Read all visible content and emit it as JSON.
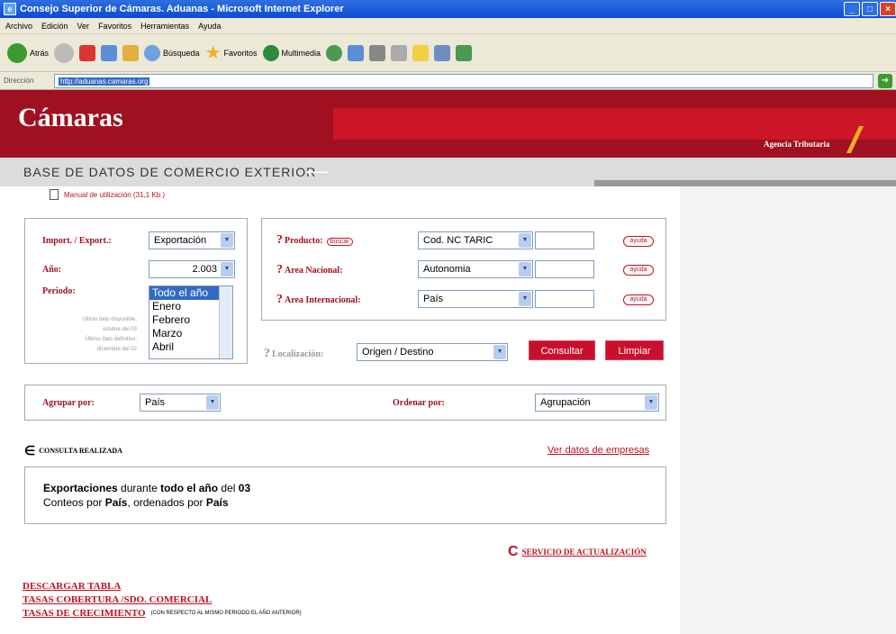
{
  "window": {
    "title": "Consejo Superior de Cámaras. Aduanas - Microsoft Internet Explorer"
  },
  "menu": [
    "Archivo",
    "Edición",
    "Ver",
    "Favoritos",
    "Herramientas",
    "Ayuda"
  ],
  "toolbar": {
    "back": "Atrás",
    "search": "Búsqueda",
    "favorites": "Favoritos",
    "media": "Multimedia"
  },
  "address": {
    "label": "Dirección",
    "url": "http://aduanas.camaras.org"
  },
  "banner": {
    "logo": "Cámaras",
    "agency": "Agencia Tributaria"
  },
  "page_title": "BASE DE DATOS DE COMERCIO EXTERIOR",
  "manual": "Manual de utilización (31,1 Kb.)",
  "left_form": {
    "import_export_label": "Import. / Export.:",
    "import_export_value": "Exportación",
    "year_label": "Año:",
    "year_value": "2.003",
    "period_label": "Periodo:",
    "period_options": [
      "Todo el año",
      "Enero",
      "Febrero",
      "Marzo",
      "Abril"
    ],
    "note_lines": [
      "Último dato disponible:",
      "octubre del 03",
      "Último dato definitivo:",
      "diciembre del 02"
    ]
  },
  "right_form": {
    "product_label": "Producto:",
    "search_button": "buscar",
    "product_value": "Cod. NC TARIC",
    "national_label": "Area Nacional:",
    "national_value": "Autonomia",
    "international_label": "Area Internacional:",
    "international_value": "País",
    "help": "ayuda"
  },
  "location": {
    "label": "Localización:",
    "value": "Origen / Destino"
  },
  "buttons": {
    "consult": "Consultar",
    "clear": "Limpiar"
  },
  "group": {
    "label": "Agrupar por:",
    "value": "País"
  },
  "order": {
    "label": "Ordenar por:",
    "value": "Agrupación"
  },
  "query": {
    "heading": "CONSULTA REALIZADA",
    "companies_link": "Ver datos de empresas",
    "line1_a": "Exportaciones",
    "line1_b": " durante ",
    "line1_c": "todo el año",
    "line1_d": " del ",
    "line1_e": "03",
    "line2_a": "Conteos por ",
    "line2_b": "País",
    "line2_c": ", ordenados por ",
    "line2_d": "País"
  },
  "update_service": "SERVICIO DE ACTUALIZACIÓN",
  "downloads": {
    "download_table": "DESCARGAR TABLA",
    "coverage": "TASAS COBERTURA /SDO. COMERCIAL",
    "growth": "TASAS DE CRECIMIENTO",
    "growth_note": "(CON RESPECTO AL MISMO PERIODO EL AÑO ANTERIOR)"
  }
}
